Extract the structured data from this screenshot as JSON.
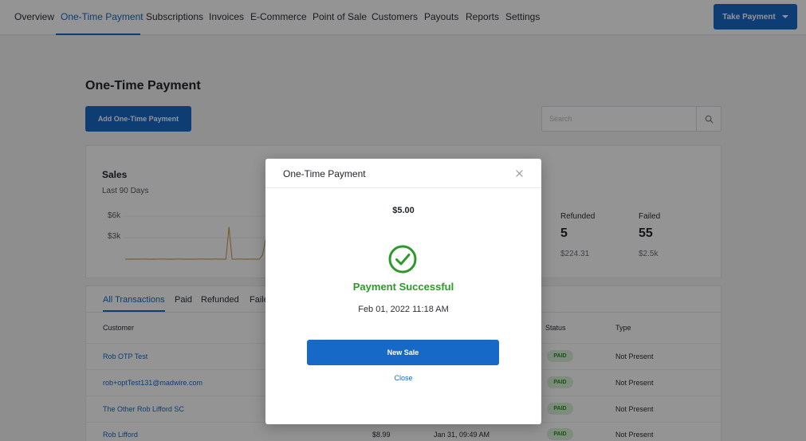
{
  "nav": {
    "items": [
      {
        "label": "Overview"
      },
      {
        "label": "One-Time Payment"
      },
      {
        "label": "Subscriptions"
      },
      {
        "label": "Invoices"
      },
      {
        "label": "E-Commerce"
      },
      {
        "label": "Point of Sale"
      },
      {
        "label": "Customers"
      },
      {
        "label": "Payouts"
      },
      {
        "label": "Reports"
      },
      {
        "label": "Settings"
      }
    ],
    "active_index": 1,
    "take_payment_label": "Take Payment"
  },
  "page": {
    "title": "One-Time Payment",
    "add_button_label": "Add One-Time Payment",
    "search_placeholder": "Search"
  },
  "sales": {
    "title": "Sales",
    "subtitle": "Last 90 Days",
    "y_ticks": [
      "$6k",
      "$3k"
    ],
    "stats": [
      {
        "label": "Refunded",
        "value": "5",
        "amount": "$224.31"
      },
      {
        "label": "Failed",
        "value": "55",
        "amount": "$2.5k"
      }
    ]
  },
  "chart_data": {
    "type": "line",
    "title": "",
    "xlabel": "",
    "ylabel": "",
    "y_tick_labels": [
      "$6k",
      "$3k"
    ],
    "ylim": [
      0,
      6000
    ],
    "grid": true,
    "series": [
      {
        "values": [
          0,
          5,
          10,
          5,
          8,
          5,
          10,
          6,
          5,
          8,
          5,
          10,
          6,
          8,
          5,
          10,
          5,
          8,
          6,
          5,
          10,
          5,
          8,
          5,
          6,
          10,
          5,
          8,
          5,
          6,
          10,
          5,
          5,
          5,
          4500,
          10,
          5,
          8,
          6,
          5,
          10,
          5,
          8,
          5,
          6,
          600,
          2800,
          200,
          8,
          5,
          10,
          6,
          5,
          8,
          5,
          10,
          5,
          6,
          8,
          5
        ]
      }
    ]
  },
  "transactions": {
    "tabs": [
      "All Transactions",
      "Paid",
      "Refunded",
      "Faile"
    ],
    "active_tab_index": 0,
    "headers": {
      "customer": "Customer",
      "status": "Status",
      "type": "Type"
    },
    "rows": [
      {
        "customer": "Rob OTP Test",
        "amount": "",
        "date": "",
        "status": "PAID",
        "type": "Not Present"
      },
      {
        "customer": "rob+optTest131@madwire.com",
        "amount": "",
        "date": "",
        "status": "PAID",
        "type": "Not Present"
      },
      {
        "customer": "The Other Rob Lifford SC",
        "amount": "",
        "date": "",
        "status": "PAID",
        "type": "Not Present"
      },
      {
        "customer": "Rob Lifford",
        "amount": "$8.99",
        "date": "Jan 31, 09:49 AM",
        "status": "PAID",
        "type": "Not Present"
      }
    ]
  },
  "modal": {
    "title": "One-Time Payment",
    "amount": "$5.00",
    "success_text": "Payment Successful",
    "datetime": "Feb 01, 2022 11:18 AM",
    "new_sale_label": "New Sale",
    "close_label": "Close"
  },
  "colors": {
    "accent": "#1769c7",
    "success": "#2c9a2a",
    "chart_line": "#c8933f"
  }
}
